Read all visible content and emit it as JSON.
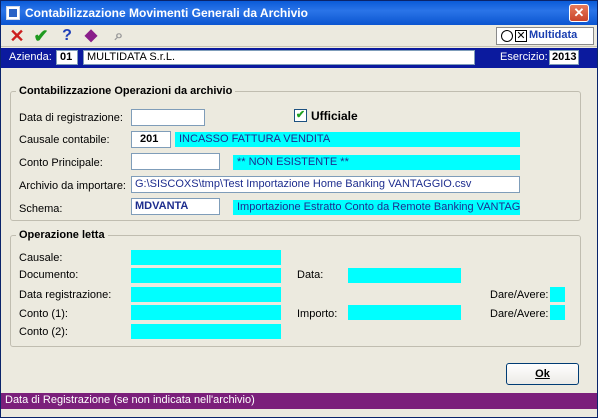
{
  "window": {
    "title": "Contabilizzazione Movimenti Generali da Archivio",
    "close": "✕"
  },
  "toolbar": {
    "cancel": "✕",
    "confirm": "✔",
    "help": "?",
    "diamond": "◆",
    "search": "⌕",
    "logo_text": "Multidata",
    "logo_x": "✕"
  },
  "company": {
    "label": "Azienda:",
    "code": "01",
    "name": "MULTIDATA S.r.L.",
    "year_label": "Esercizio:",
    "year": "2013"
  },
  "group1": {
    "title": "Contabilizzazione Operazioni da archivio",
    "data_reg_label": "Data di registrazione:",
    "data_reg_value": "",
    "ufficiale_label": "Ufficiale",
    "ufficiale_checked": true,
    "check_glyph": "✔",
    "causale_label": "Causale contabile:",
    "causale_code": "201",
    "causale_desc": "INCASSO FATTURA VENDITA",
    "conto_label": "Conto Principale:",
    "conto_value": "",
    "conto_desc": "** NON ESISTENTE **",
    "archivio_label": "Archivio da importare:",
    "archivio_value": "G:\\SISCOXS\\tmp\\Test Importazione Home Banking VANTAGGIO.csv",
    "schema_label": "Schema:",
    "schema_value": "MDVANTA",
    "schema_desc": "Importazione Estratto Conto da Remote Banking VANTAGGIO"
  },
  "group2": {
    "title": "Operazione letta",
    "causale_label": "Causale:",
    "documento_label": "Documento:",
    "data_label": "Data:",
    "data_reg_label": "Data registrazione:",
    "dare_avere_label1": "Dare/Avere:",
    "conto1_label": "Conto (1):",
    "importo_label": "Importo:",
    "dare_avere_label2": "Dare/Avere:",
    "conto2_label": "Conto (2):"
  },
  "buttons": {
    "ok": "Ok"
  },
  "status": {
    "text": "Data di Registrazione (se non indicata nell'archivio)"
  },
  "colors": {
    "accent": "#0b1a9e",
    "highlight": "#00ffff",
    "status": "#7b1f7b"
  }
}
